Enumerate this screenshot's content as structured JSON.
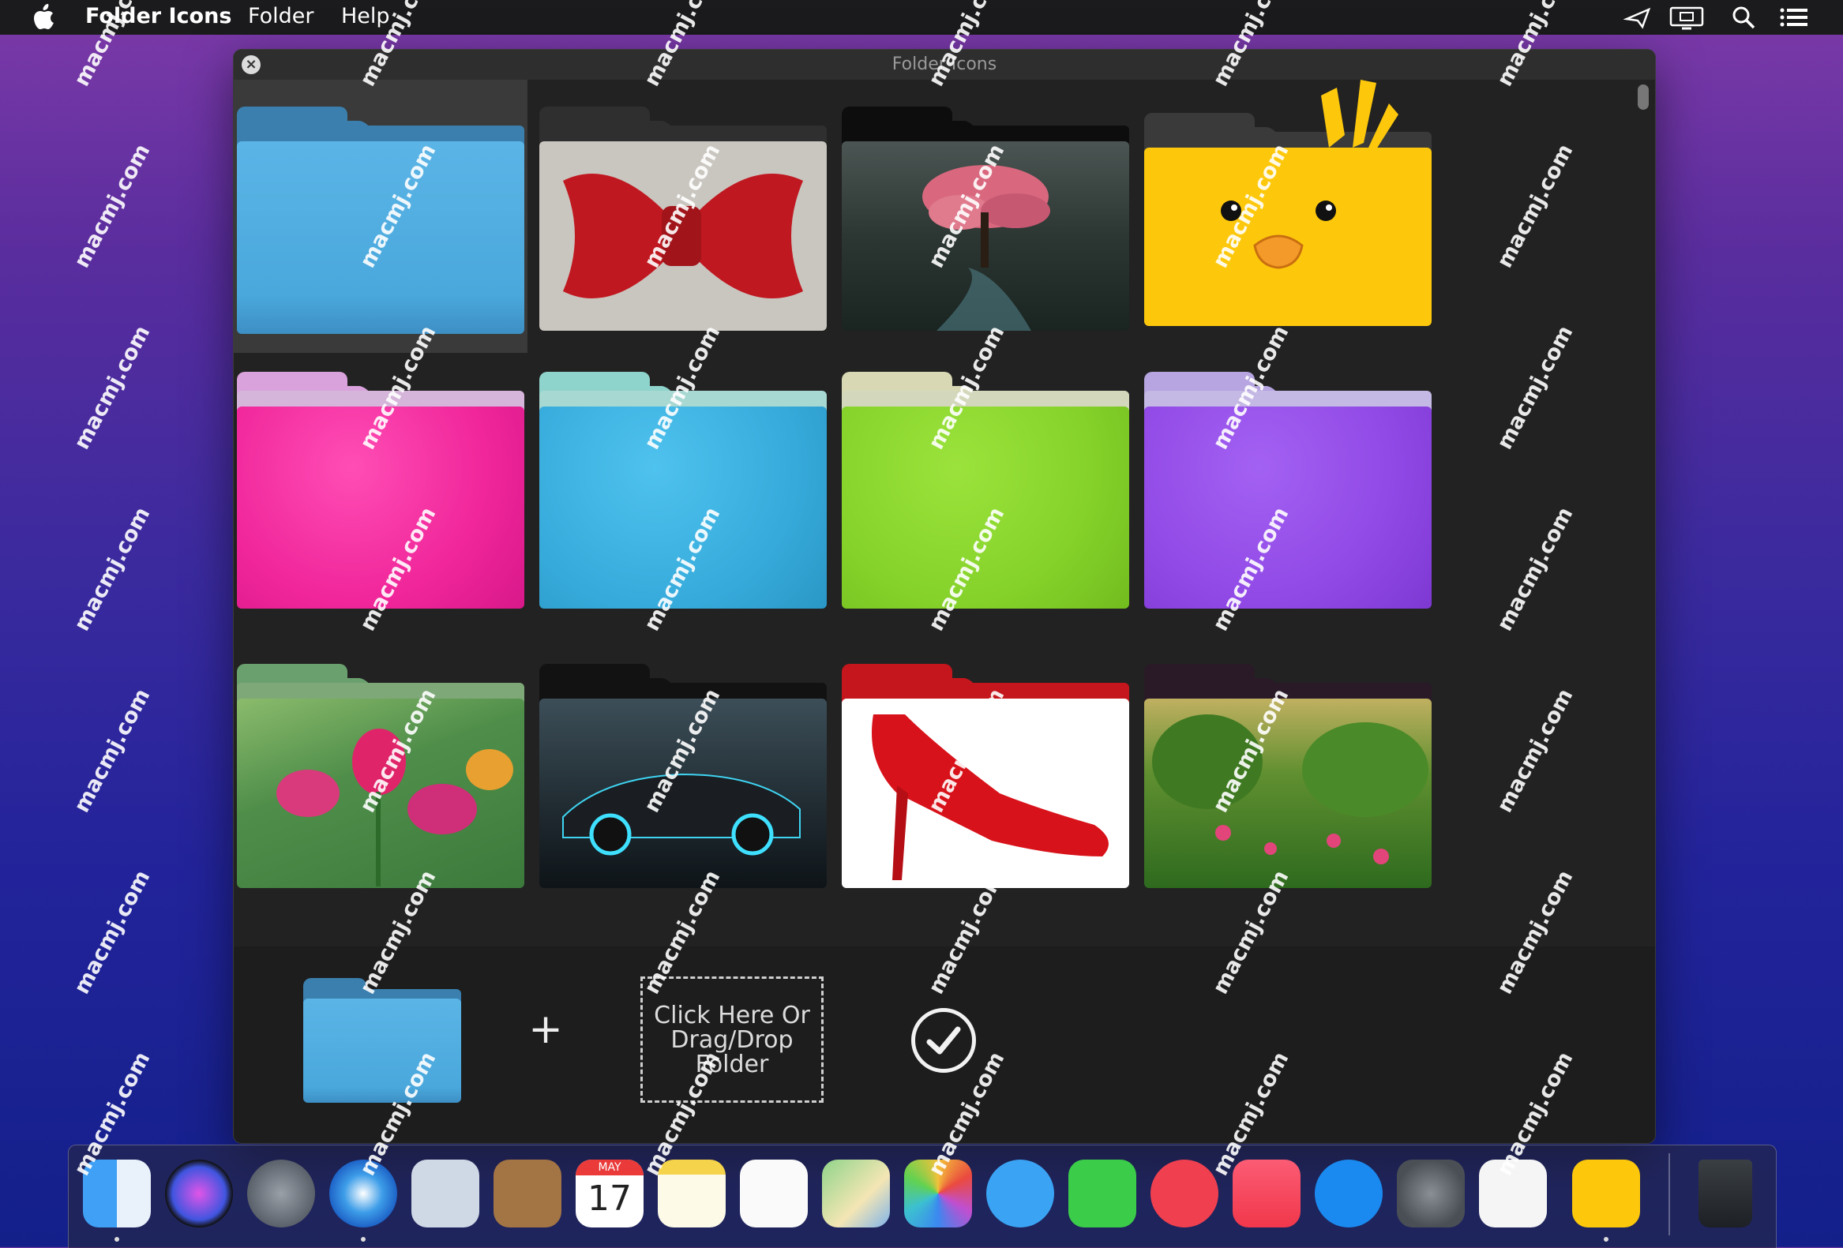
{
  "menubar": {
    "app_name": "Folder Icons",
    "menus": [
      "Folder",
      "Help"
    ]
  },
  "window": {
    "title": "Folder Icons"
  },
  "icons": [
    {
      "name": "blue-default-folder",
      "row": 0,
      "col": 0,
      "selected": true
    },
    {
      "name": "red-bowtie-folder",
      "row": 0,
      "col": 1
    },
    {
      "name": "cherry-tree-folder",
      "row": 0,
      "col": 2
    },
    {
      "name": "yellow-duck-folder",
      "row": 0,
      "col": 3
    },
    {
      "name": "pink-leather-folder",
      "row": 1,
      "col": 0
    },
    {
      "name": "blue-leather-folder",
      "row": 1,
      "col": 1
    },
    {
      "name": "green-leather-folder",
      "row": 1,
      "col": 2
    },
    {
      "name": "purple-leather-folder",
      "row": 1,
      "col": 3
    },
    {
      "name": "tulips-folder",
      "row": 2,
      "col": 0
    },
    {
      "name": "sports-car-folder",
      "row": 2,
      "col": 1
    },
    {
      "name": "red-heel-folder",
      "row": 2,
      "col": 2
    },
    {
      "name": "garden-folder",
      "row": 2,
      "col": 3
    }
  ],
  "bottom": {
    "plus": "+",
    "drop_zone": "Click Here Or Drag/Drop Folder"
  },
  "watermark": "macmj.com",
  "calendar": {
    "month": "MAY",
    "day": "17"
  },
  "dock": [
    "Finder",
    "Siri",
    "Launchpad",
    "Safari",
    "Mail",
    "Contacts",
    "Calendar",
    "Notes",
    "Reminders",
    "Maps",
    "Photos",
    "Messages",
    "FaceTime",
    "News",
    "Music",
    "App Store",
    "System Preferences",
    "TextEdit",
    "Folder Icons",
    "Trash"
  ]
}
